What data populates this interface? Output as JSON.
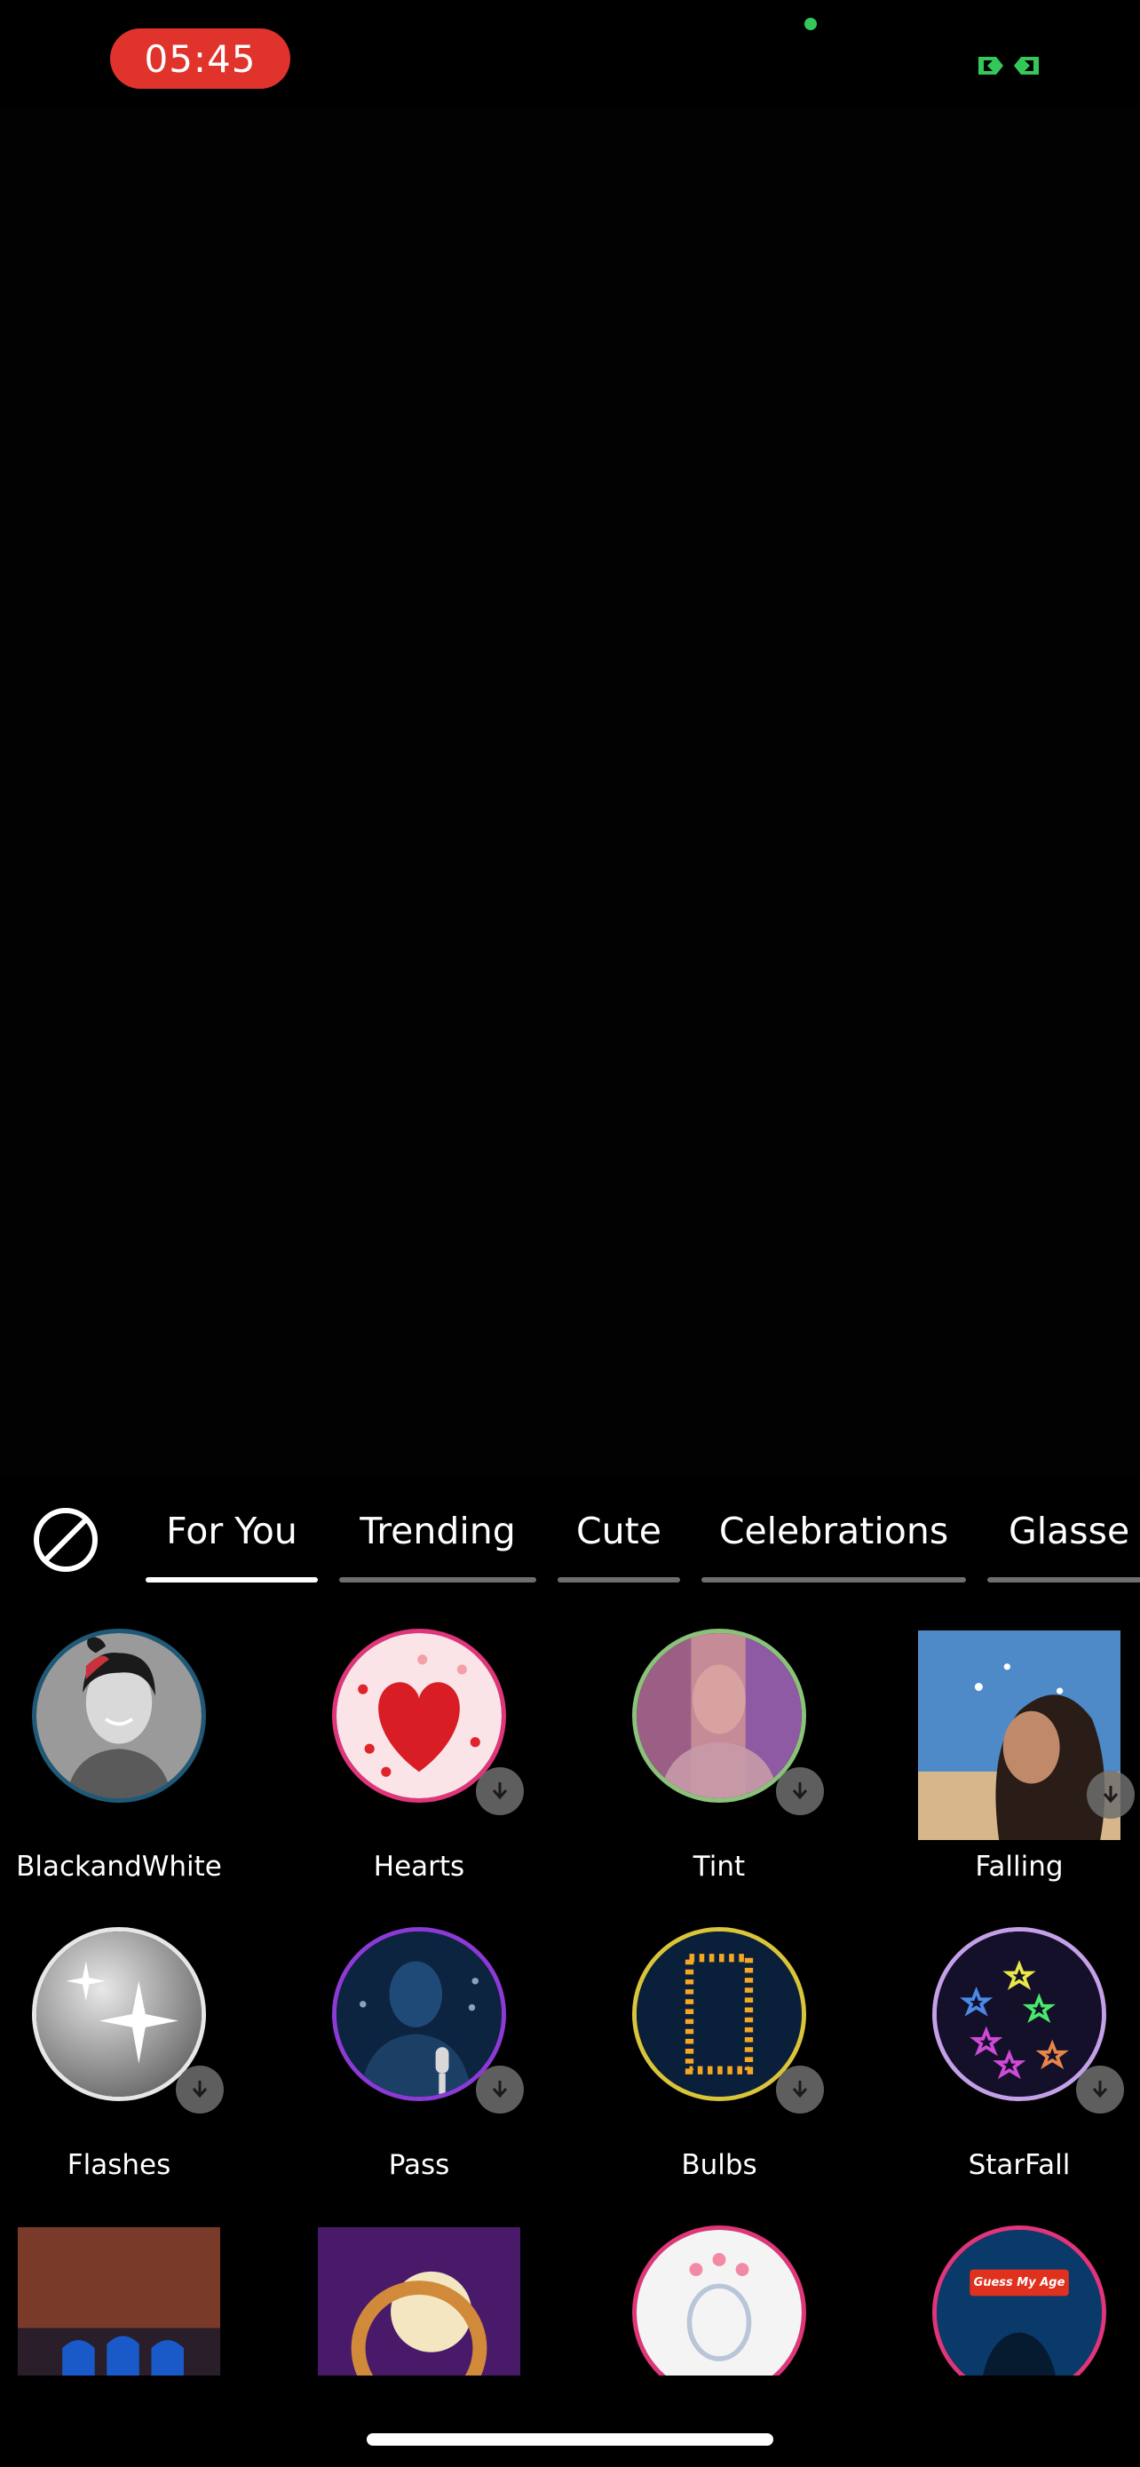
{
  "status": {
    "time": "05:45",
    "accent": "#e0332c",
    "indicator_color": "#34c759"
  },
  "tabs": [
    {
      "label": "For You",
      "active": true
    },
    {
      "label": "Trending",
      "active": false
    },
    {
      "label": "Cute",
      "active": false
    },
    {
      "label": "Celebrations",
      "active": false
    },
    {
      "label": "Glasse",
      "active": false
    }
  ],
  "effects": [
    {
      "label": "BlackandWhite",
      "icon": "portrait-bw-thumb"
    },
    {
      "label": "Hearts",
      "icon": "heart-thumb",
      "download": true
    },
    {
      "label": "Tint",
      "icon": "tint-thumb",
      "download": true
    },
    {
      "label": "Falling",
      "icon": "falling-photo-thumb",
      "download": true
    },
    {
      "label": "Flashes",
      "icon": "sparkle-thumb",
      "download": true
    },
    {
      "label": "Pass",
      "icon": "microphone-thumb",
      "download": true
    },
    {
      "label": "Bulbs",
      "icon": "bulb-frame-thumb",
      "download": true
    },
    {
      "label": "StarFall",
      "icon": "star-fall-thumb",
      "download": true
    },
    {
      "label": "",
      "icon": "cricket-team-thumb"
    },
    {
      "label": "",
      "icon": "diwali-lamp-thumb"
    },
    {
      "label": "",
      "icon": "heart-halo-thumb"
    },
    {
      "label": "Guess My Age",
      "icon": "guess-age-thumb"
    }
  ]
}
